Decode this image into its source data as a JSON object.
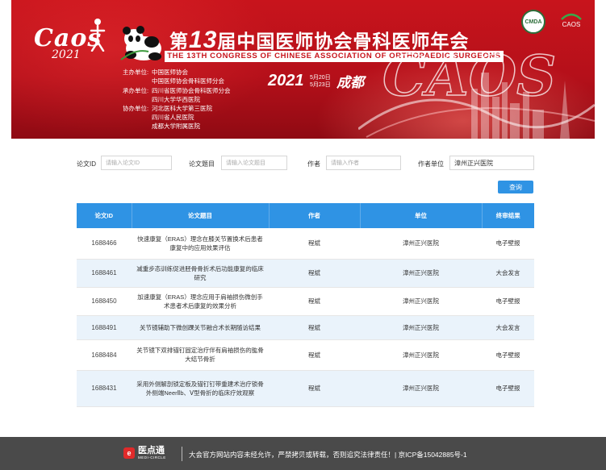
{
  "banner": {
    "caos_word": "Caos",
    "caos_year": "2021",
    "title_prefix": "第",
    "title_number": "13",
    "title_main": "届中国医师协会骨科医师年会",
    "title_en": "THE 13TH CONGRESS OF CHINESE ASSOCIATION OF ORTHOPAEDIC SURGEONS",
    "logo_cmda": "CMDA",
    "logo_caos_small": "CAOS",
    "organizers": [
      {
        "label": "主办单位:",
        "lines": [
          "中国医师协会",
          "中国医师协会骨科医师分会"
        ]
      },
      {
        "label": "承办单位:",
        "lines": [
          "四川省医师协会骨科医师分会",
          "四川大学华西医院"
        ]
      },
      {
        "label": "协办单位:",
        "lines": [
          "河北医科大学第三医院",
          "四川省人民医院",
          "成都大学附属医院"
        ]
      }
    ],
    "date_year": "2021",
    "date_start": "5月20日",
    "date_end": "5月23日",
    "city": "成都",
    "skyline_text": "CAOS"
  },
  "search": {
    "paper_id_label": "论文ID",
    "paper_id_placeholder": "请输入论文ID",
    "title_label": "论文题目",
    "title_placeholder": "请输入论文题目",
    "author_label": "作者",
    "author_placeholder": "请输入作者",
    "unit_label": "作者单位",
    "unit_value": "漳州正兴医院",
    "query_button": "查询"
  },
  "table": {
    "headers": [
      "论文ID",
      "论文题目",
      "作者",
      "单位",
      "终审结果"
    ],
    "rows": [
      {
        "id": "1688466",
        "title": "快速康复（ERAS）理念在膝关节置换术后患者康复中的应用效果评估",
        "author": "程斌",
        "unit": "漳州正兴医院",
        "result": "电子壁报"
      },
      {
        "id": "1688461",
        "title": "减重步态训练促进胫骨骨折术后功能康复的临床研究",
        "author": "程斌",
        "unit": "漳州正兴医院",
        "result": "大会发言"
      },
      {
        "id": "1688450",
        "title": "加速康复（ERAS）理念应用于肩袖损伤微创手术患者术后康复的效果分析",
        "author": "程斌",
        "unit": "漳州正兴医院",
        "result": "电子壁报"
      },
      {
        "id": "1688491",
        "title": "关节镜辅助下微创踝关节融合术长期随访结果",
        "author": "程斌",
        "unit": "漳州正兴医院",
        "result": "大会发言"
      },
      {
        "id": "1688484",
        "title": "关节镜下双排锚钉固定治疗伴有肩袖损伤的肱骨大结节骨折",
        "author": "程斌",
        "unit": "漳州正兴医院",
        "result": "电子壁报"
      },
      {
        "id": "1688431",
        "title": "采用外侧解剖锁定板及锚钉钉带重建术治疗锁骨外侧端NeerⅡb、Ⅴ型骨折的临床疗效观察",
        "author": "程斌",
        "unit": "漳州正兴医院",
        "result": "电子壁报"
      }
    ]
  },
  "footer": {
    "brand_icon": "e",
    "brand_name": "医点通",
    "brand_sub": "MEDI-CIRCLE",
    "notice": "大会官方网站内容未经允许，严禁拷贝或转载，否则追究法律责任！| 京ICP备15042885号-1"
  },
  "colors": {
    "banner_red": "#c8141c",
    "accent_blue": "#2f93e4",
    "row_alt": "#eaf3fb",
    "footer_bg": "#4a4a4a"
  }
}
